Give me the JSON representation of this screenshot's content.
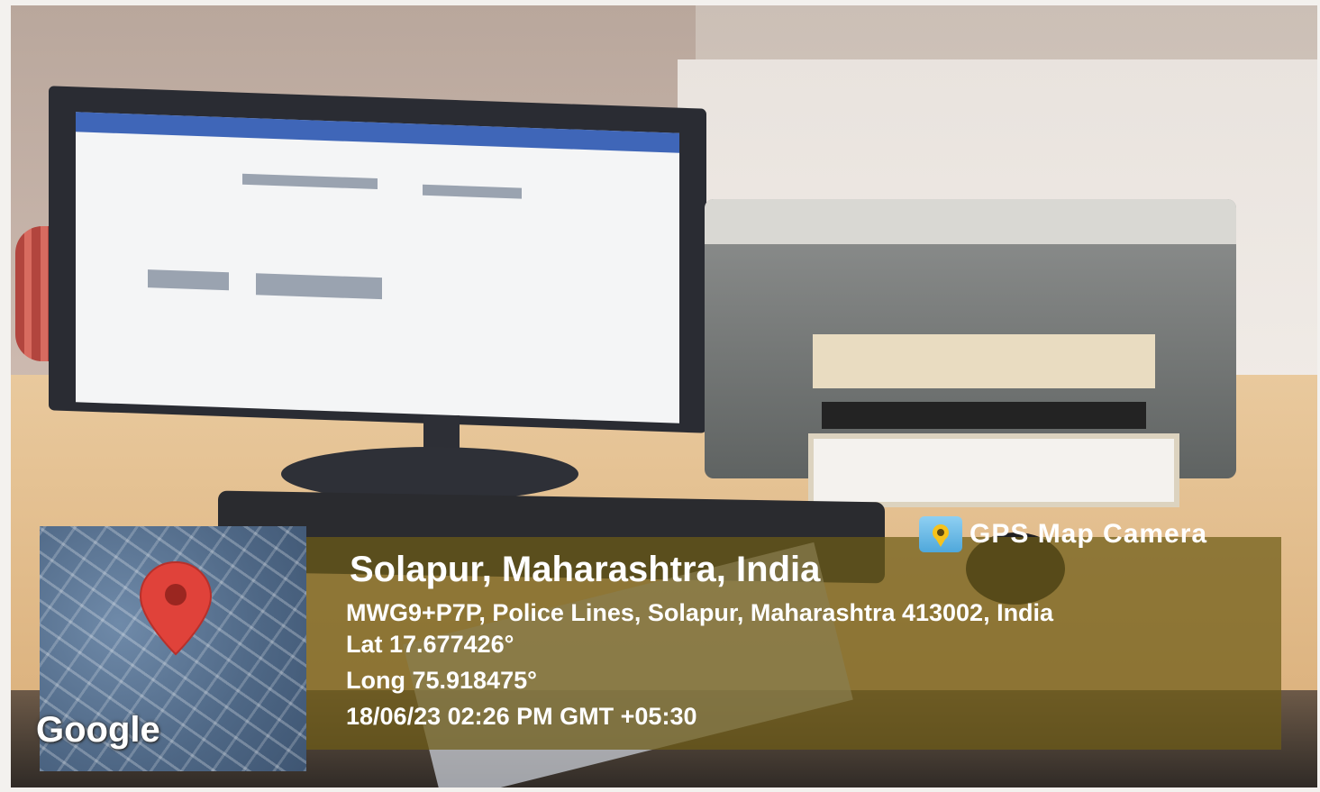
{
  "overlay": {
    "app_name": "GPS Map Camera",
    "location_title": "Solapur, Maharashtra, India",
    "address": "MWG9+P7P, Police Lines, Solapur, Maharashtra 413002, India",
    "latitude": "Lat 17.677426°",
    "longitude": "Long 75.918475°",
    "timestamp": "18/06/23 02:26 PM GMT +05:30",
    "map_attribution": "Google",
    "overlay_color": "#6e5c16",
    "pin_color": "#e0423a"
  }
}
